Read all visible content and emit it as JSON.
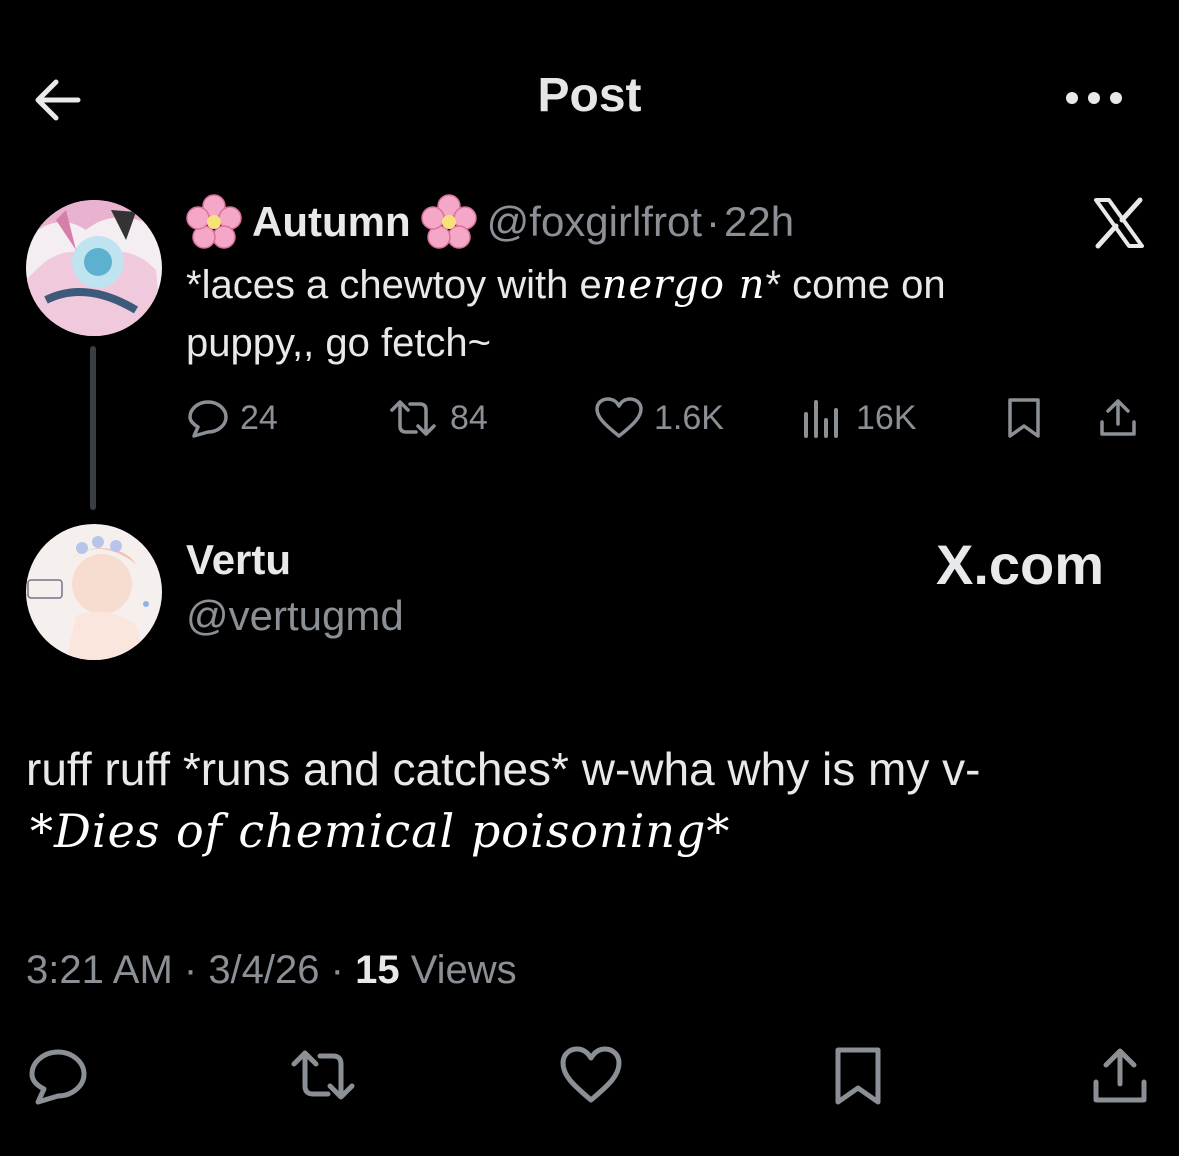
{
  "header": {
    "title": "Post"
  },
  "post1": {
    "name": "Autumn",
    "handle": "@foxgirlfrot",
    "separator": "·",
    "time": "22h",
    "text_part1": "*laces a chewtoy with e",
    "text_scribble": "nergo n",
    "text_part2": "* come on",
    "text_line2": "puppy,, go fetch~",
    "stats": {
      "replies": "24",
      "reposts": "84",
      "likes": "1.6K",
      "views": "16K"
    }
  },
  "post2": {
    "name": "Vertu",
    "handle": "@vertugmd",
    "watermark": "X.com",
    "text_line1": "ruff ruff *runs and catches* w-wha why is my v-",
    "text_line2_handwritten": "*Dies of chemical poisoning*",
    "meta": {
      "time": "3:21 AM",
      "sep1": " · ",
      "date": "3/4/26",
      "sep2": " · ",
      "views_count": "15",
      "views_label": " Views"
    }
  },
  "icons": {
    "back": "back-arrow-icon",
    "more": "more-horizontal-icon",
    "x_logo": "x-logo-icon",
    "flower": "cherry-blossom-emoji",
    "reply": "reply-icon",
    "repost": "repost-icon",
    "like": "heart-icon",
    "views": "views-bar-icon",
    "bookmark": "bookmark-icon",
    "share": "share-icon"
  },
  "colors": {
    "background": "#000000",
    "text": "#e7e9ea",
    "muted": "#8b9096",
    "flower_pink": "#f4a7c7"
  }
}
